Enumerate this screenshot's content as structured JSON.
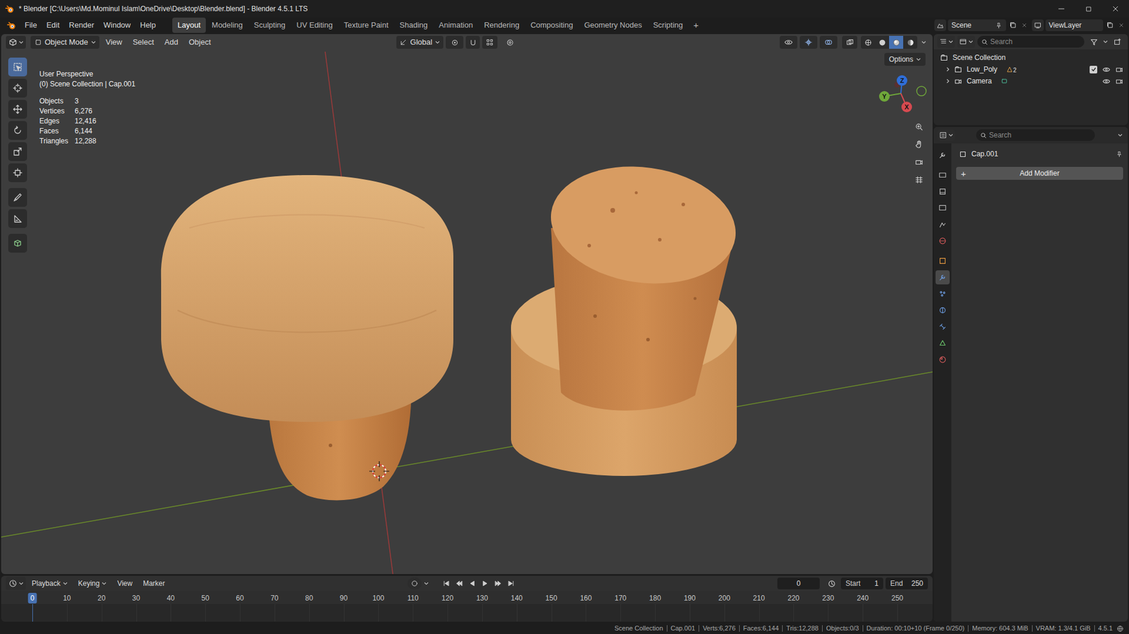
{
  "window": {
    "title": "* Blender [C:\\Users\\Md.Mominul Islam\\OneDrive\\Desktop\\Blender.blend] - Blender 4.5.1 LTS"
  },
  "menu": [
    "File",
    "Edit",
    "Render",
    "Window",
    "Help"
  ],
  "workspaces": [
    {
      "label": "Layout",
      "selected": true
    },
    {
      "label": "Modeling",
      "selected": false
    },
    {
      "label": "Sculpting",
      "selected": false
    },
    {
      "label": "UV Editing",
      "selected": false
    },
    {
      "label": "Texture Paint",
      "selected": false
    },
    {
      "label": "Shading",
      "selected": false
    },
    {
      "label": "Animation",
      "selected": false
    },
    {
      "label": "Rendering",
      "selected": false
    },
    {
      "label": "Compositing",
      "selected": false
    },
    {
      "label": "Geometry Nodes",
      "selected": false
    },
    {
      "label": "Scripting",
      "selected": false
    }
  ],
  "workspace_add": "+",
  "scene": "Scene",
  "view_layer": "ViewLayer",
  "viewport": {
    "mode": "Object Mode",
    "menus": [
      "View",
      "Select",
      "Add",
      "Object"
    ],
    "orientation": "Global",
    "options": "Options",
    "shading": [
      {
        "selected": false
      },
      {
        "selected": false
      },
      {
        "selected": true
      },
      {
        "selected": false
      }
    ],
    "perspective": "User Perspective",
    "context": "(0) Scene Collection | Cap.001",
    "stats": [
      {
        "label": "Objects",
        "value": "3"
      },
      {
        "label": "Vertices",
        "value": "6,276"
      },
      {
        "label": "Edges",
        "value": "12,416"
      },
      {
        "label": "Faces",
        "value": "6,144"
      },
      {
        "label": "Triangles",
        "value": "12,288"
      }
    ],
    "tools": [
      {
        "selected": true
      },
      {
        "selected": false
      },
      {
        "selected": false
      },
      {
        "selected": false
      },
      {
        "selected": false
      },
      {
        "selected": false
      },
      {
        "selected": false
      },
      {
        "selected": false
      },
      {
        "selected": false
      }
    ],
    "gizmo": [
      {
        "label": "Z",
        "color": "#2f6ed8"
      },
      {
        "label": "Y",
        "color": "#6fa73a"
      },
      {
        "label": "X",
        "color": "#d64a50"
      }
    ]
  },
  "outliner": {
    "search": {
      "placeholder": "Search"
    },
    "items": [
      {
        "label": "Scene Collection",
        "kind": "scene"
      },
      {
        "label": "Low_Poly",
        "kind": "collection",
        "expanded": false,
        "badge": "2",
        "checked": true,
        "visible": true,
        "renderable": true
      },
      {
        "label": "Camera",
        "kind": "camera",
        "expanded": false,
        "visible": true,
        "renderable": true
      }
    ]
  },
  "properties": {
    "search": {
      "placeholder": "Search"
    },
    "tabs": [
      {
        "selected": false
      },
      {
        "selected": false
      },
      {
        "selected": false
      },
      {
        "selected": false
      },
      {
        "selected": false
      },
      {
        "selected": false
      },
      {
        "selected": false
      },
      {
        "selected": true
      },
      {
        "selected": false
      },
      {
        "selected": false
      },
      {
        "selected": false
      },
      {
        "selected": false
      },
      {
        "selected": false
      }
    ],
    "object": "Cap.001",
    "add_modifier_icon": "+",
    "add_modifier": "Add Modifier"
  },
  "timeline": {
    "menus": [
      {
        "label": "Playback",
        "kind": "dropdown"
      },
      {
        "label": "Keying",
        "kind": "dropdown"
      },
      {
        "label": "View",
        "kind": "menu"
      },
      {
        "label": "Marker",
        "kind": "menu"
      }
    ],
    "current_frame": "0",
    "start": {
      "label": "Start",
      "value": "1"
    },
    "end": {
      "label": "End",
      "value": "250"
    },
    "ticks": [
      {
        "label": "0",
        "selected": true
      },
      {
        "label": "10",
        "selected": false
      },
      {
        "label": "20",
        "selected": false
      },
      {
        "label": "30",
        "selected": false
      },
      {
        "label": "40",
        "selected": false
      },
      {
        "label": "50",
        "selected": false
      },
      {
        "label": "60",
        "selected": false
      },
      {
        "label": "70",
        "selected": false
      },
      {
        "label": "80",
        "selected": false
      },
      {
        "label": "90",
        "selected": false
      },
      {
        "label": "100",
        "selected": false
      },
      {
        "label": "110",
        "selected": false
      },
      {
        "label": "120",
        "selected": false
      },
      {
        "label": "130",
        "selected": false
      },
      {
        "label": "140",
        "selected": false
      },
      {
        "label": "150",
        "selected": false
      },
      {
        "label": "160",
        "selected": false
      },
      {
        "label": "170",
        "selected": false
      },
      {
        "label": "180",
        "selected": false
      },
      {
        "label": "190",
        "selected": false
      },
      {
        "label": "200",
        "selected": false
      },
      {
        "label": "210",
        "selected": false
      },
      {
        "label": "220",
        "selected": false
      },
      {
        "label": "230",
        "selected": false
      },
      {
        "label": "240",
        "selected": false
      },
      {
        "label": "250",
        "selected": false
      }
    ]
  },
  "status_bar": [
    "Scene Collection",
    "Cap.001",
    "Verts:6,276",
    "Faces:6,144",
    "Tris:12,288",
    "Objects:0/3",
    "Duration: 00:10+10 (Frame 0/250)",
    "Memory: 604.3 MiB",
    "VRAM: 1.3/4.1 GiB",
    "4.5.1"
  ]
}
